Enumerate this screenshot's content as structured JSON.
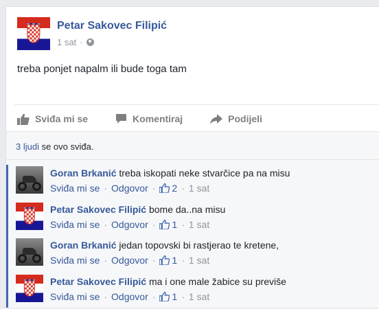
{
  "post": {
    "author": "Petar Sakovec Filipić",
    "time": "1 sat",
    "separator": "·",
    "text": "treba ponjet napalm ili bude toga tam"
  },
  "actions": {
    "like": "Sviđa mi se",
    "comment": "Komentiraj",
    "share": "Podijeli"
  },
  "likes": {
    "count": "3 ljudi",
    "suffix": "se ovo sviđa."
  },
  "comments": [
    {
      "author": "Goran Brkanić",
      "text": "treba iskopati neke stvarčice pa na misu",
      "like": "Sviđa mi se",
      "reply": "Odgovor",
      "likes": "2",
      "time": "1 sat",
      "avatar": "motorcycle"
    },
    {
      "author": "Petar Sakovec Filipić",
      "text": "bome da..na misu",
      "like": "Sviđa mi se",
      "reply": "Odgovor",
      "likes": "1",
      "time": "1 sat",
      "avatar": "croatian-flag"
    },
    {
      "author": "Goran Brkanić",
      "text": "jedan topovski bi rastjerao te kretene,",
      "like": "Sviđa mi se",
      "reply": "Odgovor",
      "likes": "1",
      "time": "1 sat",
      "avatar": "motorcycle"
    },
    {
      "author": "Petar Sakovec Filipić",
      "text": "ma i one male žabice su previše",
      "like": "Sviđa mi se",
      "reply": "Odgovor",
      "likes": "1",
      "time": "1 sat",
      "avatar": "croatian-flag"
    }
  ],
  "colors": {
    "link": "#365899",
    "accent": "#4267b2",
    "muted": "#90949c"
  }
}
